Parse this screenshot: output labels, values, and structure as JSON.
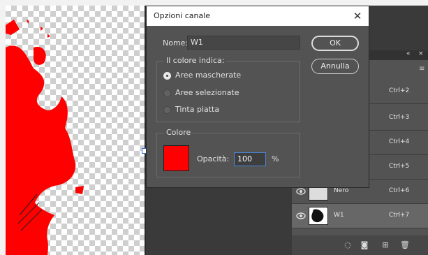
{
  "dialog": {
    "title": "Opzioni canale",
    "name_label": "Nome:",
    "name_value": "W1",
    "ok_label": "OK",
    "cancel_label": "Annulla",
    "color_indicates": {
      "title": "Il colore indica:",
      "options": [
        "Aree mascherate",
        "Aree selezionate",
        "Tinta piatta"
      ],
      "selected": "Aree mascherate"
    },
    "color_group": {
      "title": "Colore",
      "swatch_color": "#ff0000",
      "opacity_label": "Opacità:",
      "opacity_value": "100",
      "percent": "%"
    }
  },
  "channels_panel": {
    "rows": [
      {
        "name": "",
        "shortcut": "Ctrl+2"
      },
      {
        "name": "",
        "shortcut": "Ctrl+3"
      },
      {
        "name": "",
        "shortcut": "Ctrl+4"
      },
      {
        "name": "",
        "shortcut": "Ctrl+5"
      },
      {
        "name": "Nero",
        "shortcut": "Ctrl+6"
      },
      {
        "name": "W1",
        "shortcut": "Ctrl+7"
      }
    ]
  },
  "colors": {
    "mask": "#ff0000",
    "panel": "#535353",
    "dialog": "#535353"
  }
}
